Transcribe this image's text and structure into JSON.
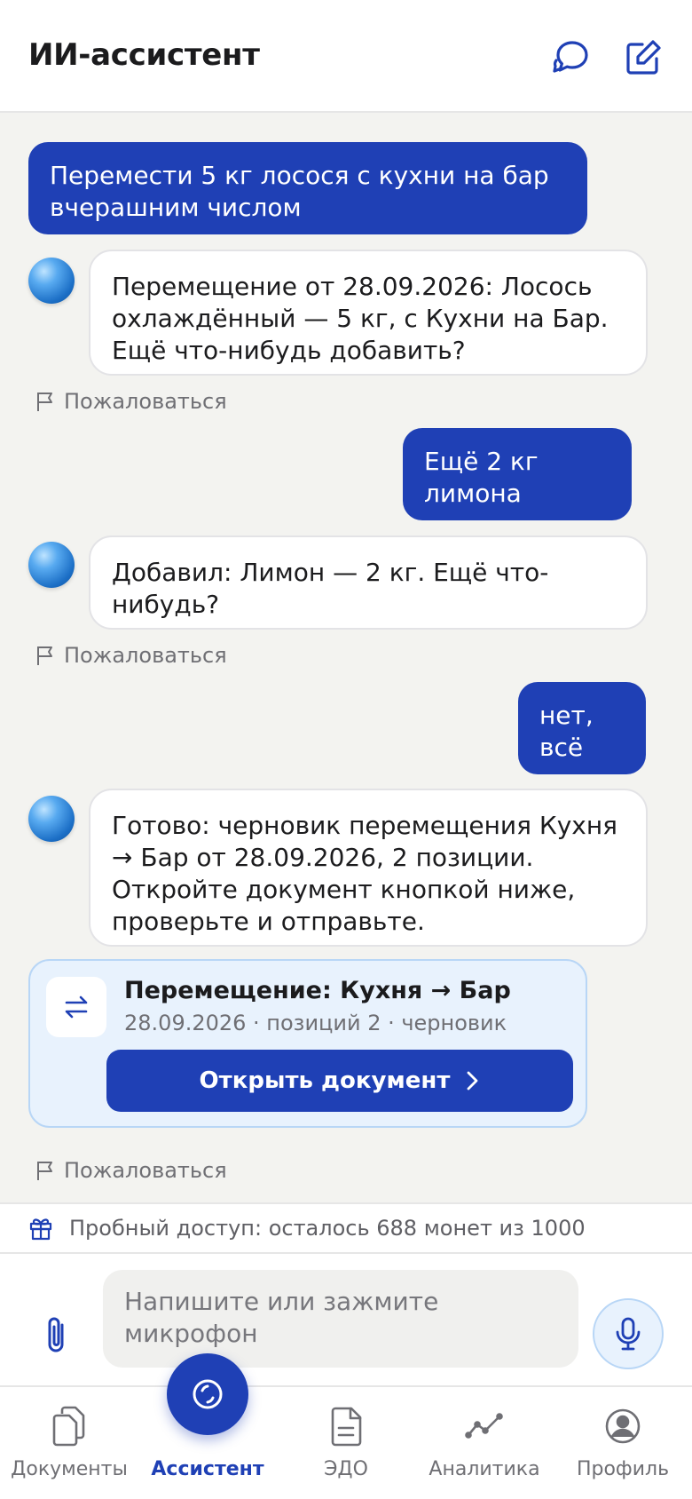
{
  "header": {
    "title": "ИИ-ассистент",
    "icons": [
      "chat-icon",
      "compose-icon"
    ]
  },
  "messages": [
    {
      "role": "user",
      "text": "Перемести 5 кг лосося с кухни на бар вчерашним числом"
    },
    {
      "role": "assistant",
      "text": "Перемещение от 28.09.2026: Лосось охлаждённый — 5 кг, с Кухни на Бар. Ещё что-нибудь добавить?",
      "complaint": "Пожаловаться"
    },
    {
      "role": "user",
      "text": "Ещё 2 кг лимона"
    },
    {
      "role": "assistant",
      "text": "Добавил: Лимон — 2 кг. Ещё что-нибудь?",
      "complaint": "Пожаловаться"
    },
    {
      "role": "user",
      "text": "нет, всё"
    },
    {
      "role": "assistant",
      "text": "Готово: черновик перемещения Кухня → Бар от 28.09.2026, 2 позиции. Откройте документ кнопкой ниже, проверьте и отправьте.",
      "complaint": "Пожаловаться"
    }
  ],
  "document_card": {
    "icon": "transfer-arrows-icon",
    "title": "Перемещение: Кухня → Бар",
    "subtitle": "28.09.2026 · позиций 2 · черновик",
    "button_label": "Открыть документ"
  },
  "trial": {
    "icon": "gift-icon",
    "text": "Пробный доступ: осталось 688 монет из 1000"
  },
  "input": {
    "placeholder": "Напишите или зажмите микрофон",
    "value": ""
  },
  "nav": {
    "items": [
      {
        "label": "Документы",
        "icon": "documents-icon"
      },
      {
        "label": "Ассистент",
        "icon": "assistant-icon",
        "active": true
      },
      {
        "label": "ЭДО",
        "icon": "edo-icon"
      },
      {
        "label": "Аналитика",
        "icon": "analytics-icon"
      },
      {
        "label": "Профиль",
        "icon": "profile-icon"
      }
    ]
  },
  "colors": {
    "accent": "#1f40b5",
    "background": "#f3f3f0",
    "card_bg": "#e8f2fd"
  }
}
